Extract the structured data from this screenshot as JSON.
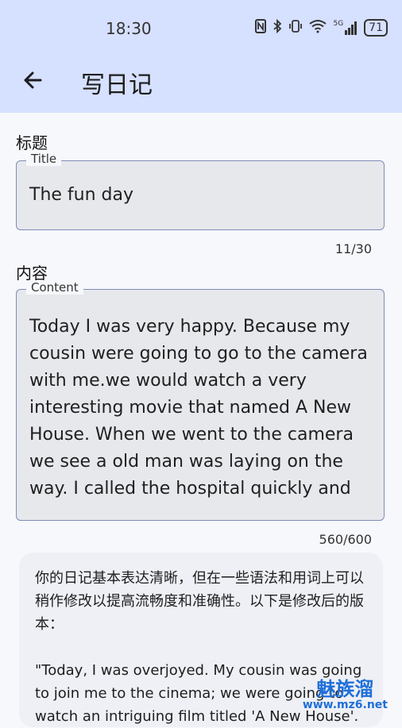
{
  "status_bar": {
    "time": "18:30",
    "icons": [
      "nfc-icon",
      "bluetooth-icon",
      "vibrate-icon",
      "wifi-icon",
      "signal-icon",
      "battery-icon"
    ],
    "network": "5G",
    "battery": "71"
  },
  "header": {
    "title": "写日记"
  },
  "title_section": {
    "label": "标题",
    "legend": "Title",
    "value": "The fun day",
    "counter": "11/30"
  },
  "content_section": {
    "label": "内容",
    "legend": "Content",
    "value": "Today I was very happy. Because my cousin were going to go to the camera with me.we would watch a very interesting movie that named A New House. When we went to the  camera we see a old man was laying on the way. I called the hospital quickly and",
    "counter": "560/600"
  },
  "ai_card": {
    "intro": "你的日记基本表达清晰，但在一些语法和用词上可以稍作修改以提高流畅度和准确性。以下是修改后的版本：",
    "revised": "\"Today, I was overjoyed. My cousin was going to join me to the cinema; we were going to watch an intriguing film titled 'A New House'."
  },
  "watermark": {
    "brand": "魅族溜",
    "url": "www.mz6.net"
  },
  "colors": {
    "header_bg": "#d6e0ff",
    "field_bg": "#e7e8ec",
    "field_border": "#7c8db6",
    "watermark": "#1f6fd9"
  }
}
